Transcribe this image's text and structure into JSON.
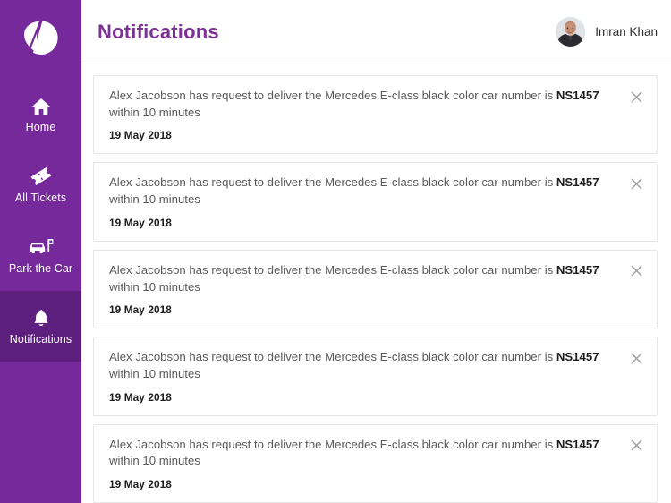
{
  "sidebar": {
    "logo_name": "valet-logo",
    "background_color": "#76299a",
    "active_background_color": "#5d1f7d",
    "items": [
      {
        "label": "Home",
        "icon": "home-icon",
        "active": false
      },
      {
        "label": "All Tickets",
        "icon": "ticket-icon",
        "active": false
      },
      {
        "label": "Park the Car",
        "icon": "car-parking-icon",
        "active": false
      },
      {
        "label": "Notifications",
        "icon": "bell-icon",
        "active": true
      }
    ]
  },
  "header": {
    "title": "Notifications",
    "title_color": "#7b3294",
    "user": {
      "name": "Imran Khan",
      "avatar_name": "user-avatar-photo"
    }
  },
  "notifications": {
    "close_icon": "close-icon",
    "items": [
      {
        "text_before": "Alex Jacobson has request to deliver the Mercedes E-class black color car number is ",
        "highlight": "NS1457",
        "text_after": " within 10 minutes",
        "date": "19 May 2018"
      },
      {
        "text_before": "Alex Jacobson has request to deliver the Mercedes E-class black color car number is ",
        "highlight": "NS1457",
        "text_after": " within 10 minutes",
        "date": "19 May 2018"
      },
      {
        "text_before": "Alex Jacobson has request to deliver the Mercedes E-class black color car number is ",
        "highlight": "NS1457",
        "text_after": " within 10 minutes",
        "date": "19 May 2018"
      },
      {
        "text_before": "Alex Jacobson has request to deliver the Mercedes E-class black color car number is ",
        "highlight": "NS1457",
        "text_after": " within 10 minutes",
        "date": "19 May 2018"
      },
      {
        "text_before": "Alex Jacobson has request to deliver the Mercedes E-class black color car number is ",
        "highlight": "NS1457",
        "text_after": " within 10 minutes",
        "date": "19 May 2018"
      }
    ]
  }
}
